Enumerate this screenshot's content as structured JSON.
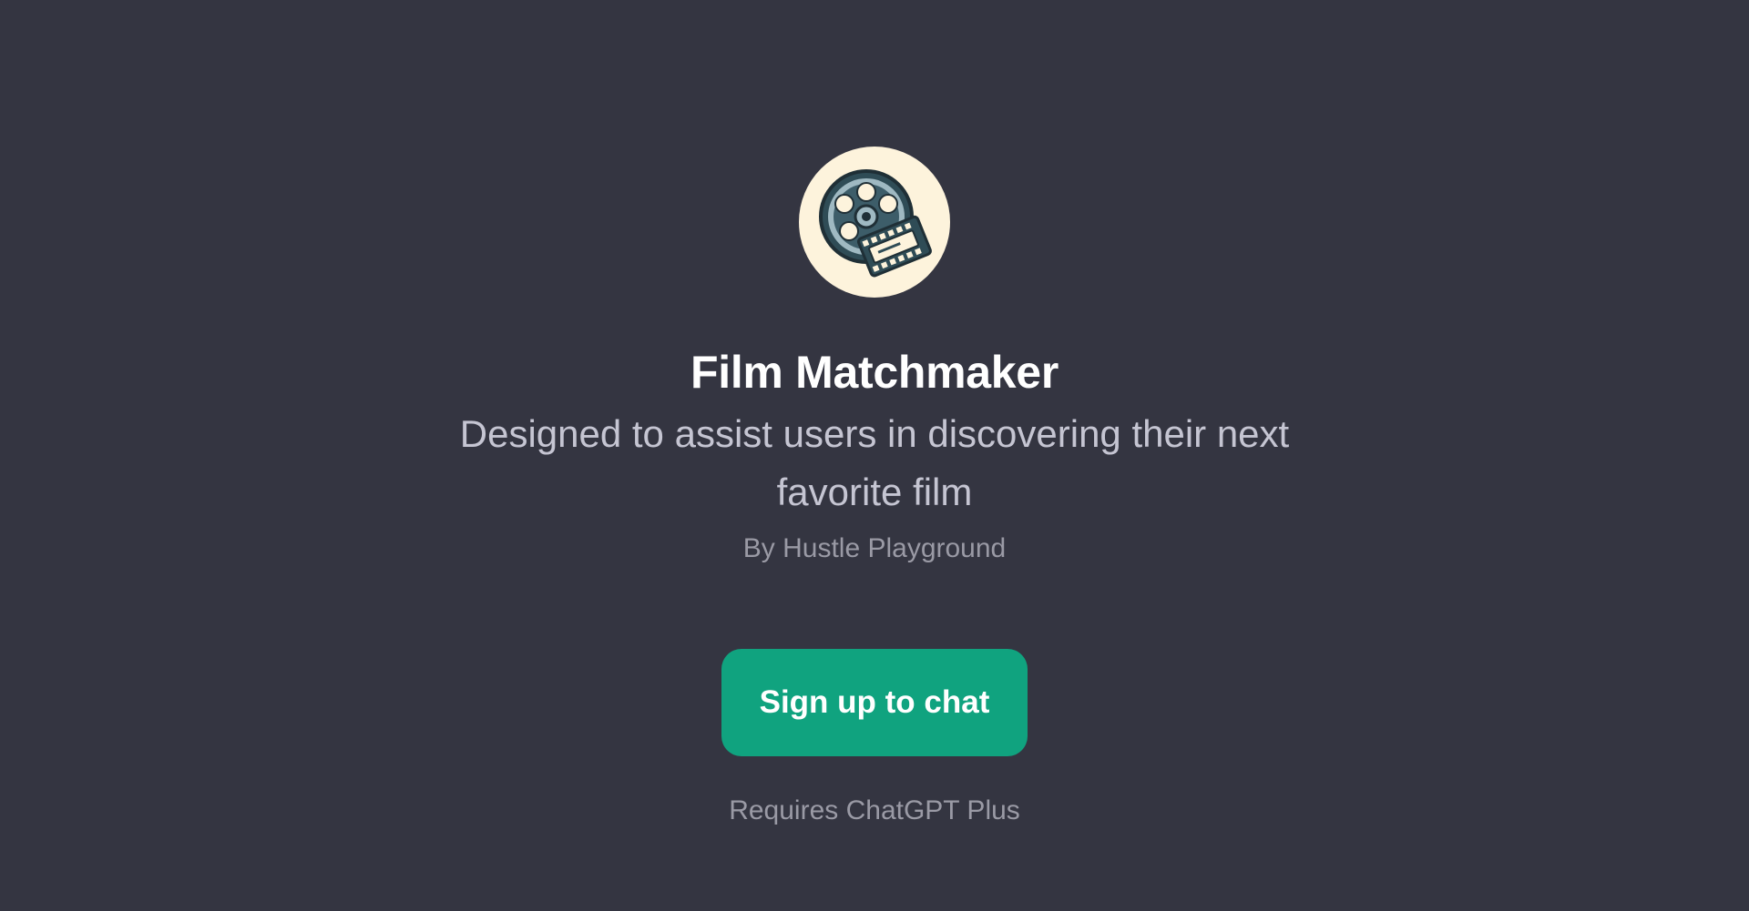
{
  "gpt": {
    "name": "Film Matchmaker",
    "description": "Designed to assist users in discovering their next favorite film",
    "author": "By Hustle Playground",
    "avatar_icon": "film-reel-ticket-icon"
  },
  "cta": {
    "label": "Sign up to chat"
  },
  "footer": {
    "requirement": "Requires ChatGPT Plus"
  },
  "colors": {
    "background": "#343541",
    "button": "#10a37f",
    "avatar_background": "#fdf3dc"
  }
}
